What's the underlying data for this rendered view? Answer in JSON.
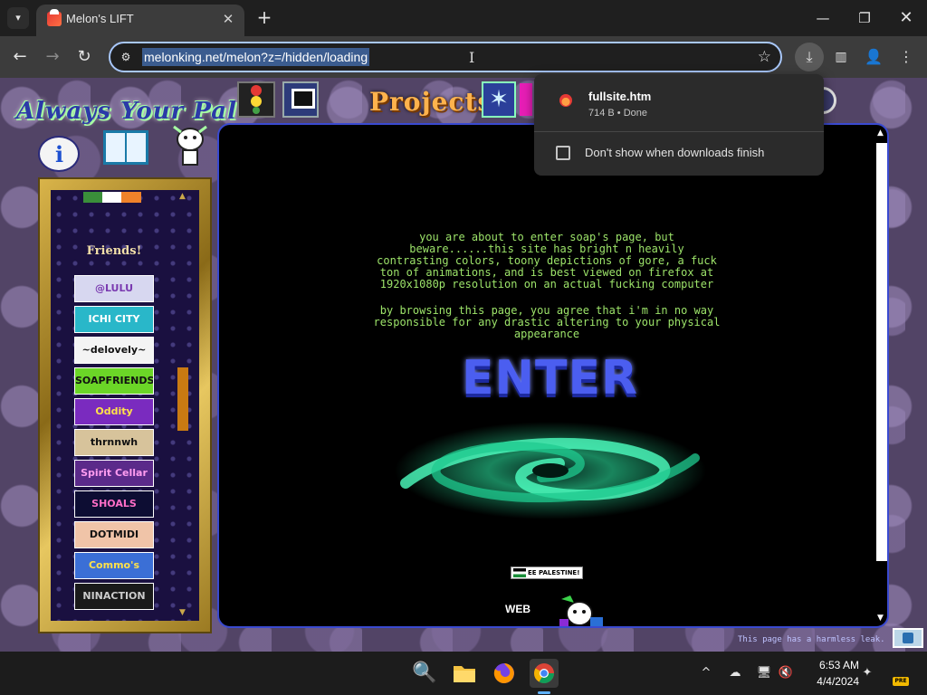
{
  "browser": {
    "tab_title": "Melon's LIFT",
    "url": "melonking.net/melon?z=/hidden/loading",
    "icons": {
      "tab_menu": "▾",
      "tab_close": "✕",
      "new_tab": "+",
      "minimize": "—",
      "maximize": "❐",
      "close": "✕",
      "back": "←",
      "forward": "→",
      "reload": "↻",
      "site_info": "⚙",
      "bookmark_star": "☆",
      "download": "⤓",
      "side_panel": "▥",
      "profile": "👤",
      "menu": "⋮"
    }
  },
  "downloads_popup": {
    "file_name": "fullsite.htm",
    "file_status": "714 B • Done",
    "checkbox_label": "Don't show when downloads finish",
    "checkbox_checked": false
  },
  "site": {
    "logo": "Always Your Pal",
    "nav_projects": "Projects",
    "star_glyph": "✶",
    "friends_title": "Friends!",
    "friends": [
      {
        "label": "@LULU",
        "bg": "#d7d7f0",
        "fg": "#7a3ab0"
      },
      {
        "label": "ICHI CITY",
        "bg": "#29b7c9",
        "fg": "#ffffff"
      },
      {
        "label": "~delovely~",
        "bg": "#f4f4f4",
        "fg": "#111111"
      },
      {
        "label": "SOAPFRIENDS",
        "bg": "#6bd627",
        "fg": "#111111"
      },
      {
        "label": "Oddity Commodity",
        "bg": "#7a2bbf",
        "fg": "#ffe14a"
      },
      {
        "label": "thrnnwh hsfid",
        "bg": "#d7c39b",
        "fg": "#111111"
      },
      {
        "label": "Spirit Cellar",
        "bg": "#5b2a8a",
        "fg": "#ff9cf0"
      },
      {
        "label": "SHOALS",
        "bg": "#0d0d33",
        "fg": "#ff6ec7"
      },
      {
        "label": "DOTMIDI",
        "bg": "#f0c4a8",
        "fg": "#111111"
      },
      {
        "label": "Commo's Space",
        "bg": "#3b6fd6",
        "fg": "#ffe14a"
      },
      {
        "label": "NINACTION",
        "bg": "#1a1a1a",
        "fg": "#cccccc"
      }
    ],
    "warning_paragraph_1": "you are about to enter soap's page, but beware......this site has bright n heavily contrasting colors, toony depictions of gore, a fuck ton of animations, and is best viewed on firefox at 1920x1080p resolution on an actual fucking computer",
    "warning_paragraph_2": "by browsing this page, you agree that i'm in no way responsible for any drastic altering to your physical appearance",
    "enter_label": "ENTER",
    "palestine_badge": "EE PALESTINE! F",
    "web_label": "WEB",
    "footer_note": "This page has a harmless leak."
  },
  "taskbar": {
    "time": "6:53 AM",
    "date": "4/4/2024",
    "pre_badge": "PRE",
    "icons": {
      "search": "🔍",
      "files": "📁",
      "firefox": "🦊",
      "chrome": "◉",
      "tray_chevron": "^",
      "onedrive": "☁",
      "display": "🖥",
      "volume_muted": "🔇",
      "network": "✦"
    }
  },
  "colors": {
    "warning_text": "#9de46a",
    "enter": "#4b5ef0",
    "frame_border": "#3a4ad0",
    "accent_blue": "#a8c7fa"
  }
}
